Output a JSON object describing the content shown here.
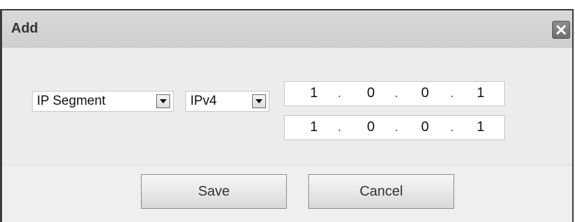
{
  "dialog": {
    "title": "Add",
    "close_icon": "close-icon"
  },
  "form": {
    "type_select": {
      "value": "IP Segment"
    },
    "version_select": {
      "value": "IPv4"
    },
    "start_ip": [
      "1",
      "0",
      "0",
      "1"
    ],
    "end_ip": [
      "1",
      "0",
      "0",
      "1"
    ],
    "ip_separator": "."
  },
  "footer": {
    "save_label": "Save",
    "cancel_label": "Cancel"
  }
}
